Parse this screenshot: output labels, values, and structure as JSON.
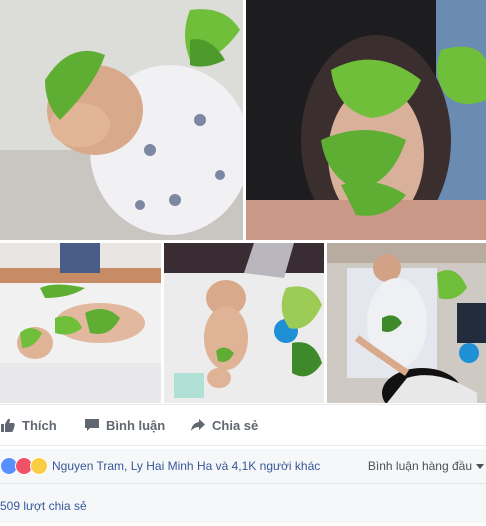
{
  "post": {
    "photos": [
      {
        "name": "newborn-leaf-on-forehead"
      },
      {
        "name": "woman-leaf-face-mask"
      },
      {
        "name": "baby-lying-with-leaves"
      },
      {
        "name": "baby-on-blanket-with-leaves"
      },
      {
        "name": "mother-tending-baby"
      }
    ]
  },
  "actions": {
    "like_label": "Thích",
    "comment_label": "Bình luận",
    "share_label": "Chia sẻ"
  },
  "reactions": {
    "icons": [
      "like-icon",
      "love-icon",
      "wow-icon"
    ],
    "names_text": "Nguyen Tram, Ly Hai Minh Ha và 4,1K người khác",
    "comment_order_label": "Bình luận hàng đầu"
  },
  "shares": {
    "count_text": "509 lượt chia sẻ"
  },
  "colors": {
    "link": "#365899",
    "action_text": "#606770",
    "like_blue": "#5890ff",
    "love_red": "#f25268",
    "wow_yellow": "#fbcd44",
    "leaf_green": "#6fbf3a"
  }
}
